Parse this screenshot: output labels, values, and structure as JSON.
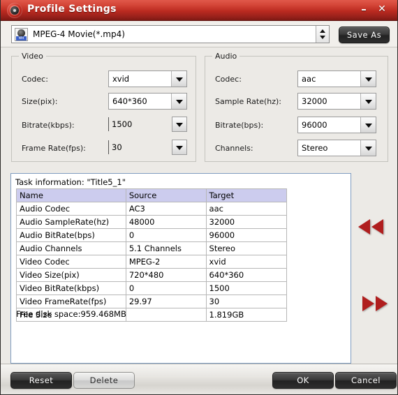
{
  "window": {
    "title": "Profile Settings",
    "icon": "app-disc-icon",
    "minimize_label": "–",
    "close_label": "✕",
    "titlebar_color": "#bb2a20"
  },
  "format_bar": {
    "profile_value": "MPEG-4 Movie(*.mp4)",
    "profile_icon": "mp4-file-icon",
    "save_as_label": "Save As"
  },
  "video_group": {
    "legend": "Video",
    "fields": [
      {
        "label": "Codec:",
        "value": "xvid"
      },
      {
        "label": "Size(pix):",
        "value": "640*360"
      },
      {
        "label": "Bitrate(kbps):",
        "value": "1500"
      },
      {
        "label": "Frame Rate(fps):",
        "value": "30"
      }
    ]
  },
  "audio_group": {
    "legend": "Audio",
    "fields": [
      {
        "label": "Codec:",
        "value": "aac"
      },
      {
        "label": "Sample Rate(hz):",
        "value": "32000"
      },
      {
        "label": "Bitrate(bps):",
        "value": "96000"
      },
      {
        "label": "Channels:",
        "value": "Stereo"
      }
    ]
  },
  "task_info": {
    "title": "Task information: \"Title5_1\"",
    "columns": [
      "Name",
      "Source",
      "Target"
    ],
    "rows": [
      {
        "name": "Audio Codec",
        "source": "AC3",
        "target": "aac"
      },
      {
        "name": "Audio SampleRate(hz)",
        "source": "48000",
        "target": "32000"
      },
      {
        "name": "Audio BitRate(bps)",
        "source": "0",
        "target": "96000"
      },
      {
        "name": "Audio Channels",
        "source": "5.1 Channels",
        "target": "Stereo"
      },
      {
        "name": "Video Codec",
        "source": "MPEG-2",
        "target": "xvid"
      },
      {
        "name": "Video Size(pix)",
        "source": "720*480",
        "target": "640*360"
      },
      {
        "name": "Video BitRate(kbps)",
        "source": "0",
        "target": "1500"
      },
      {
        "name": "Video FrameRate(fps)",
        "source": "29.97",
        "target": "30"
      },
      {
        "name": "File Size",
        "source": "",
        "target": "1.819GB"
      }
    ],
    "disk_space": "Free disk space:959.468MB",
    "header_color": "#ccccee"
  },
  "navigation": {
    "prev_icon": "double-arrow-left-icon",
    "next_icon": "double-arrow-right-icon",
    "arrow_color": "#b01e1e"
  },
  "footer": {
    "reset_label": "Reset",
    "delete_label": "Delete",
    "ok_label": "OK",
    "cancel_label": "Cancel"
  }
}
